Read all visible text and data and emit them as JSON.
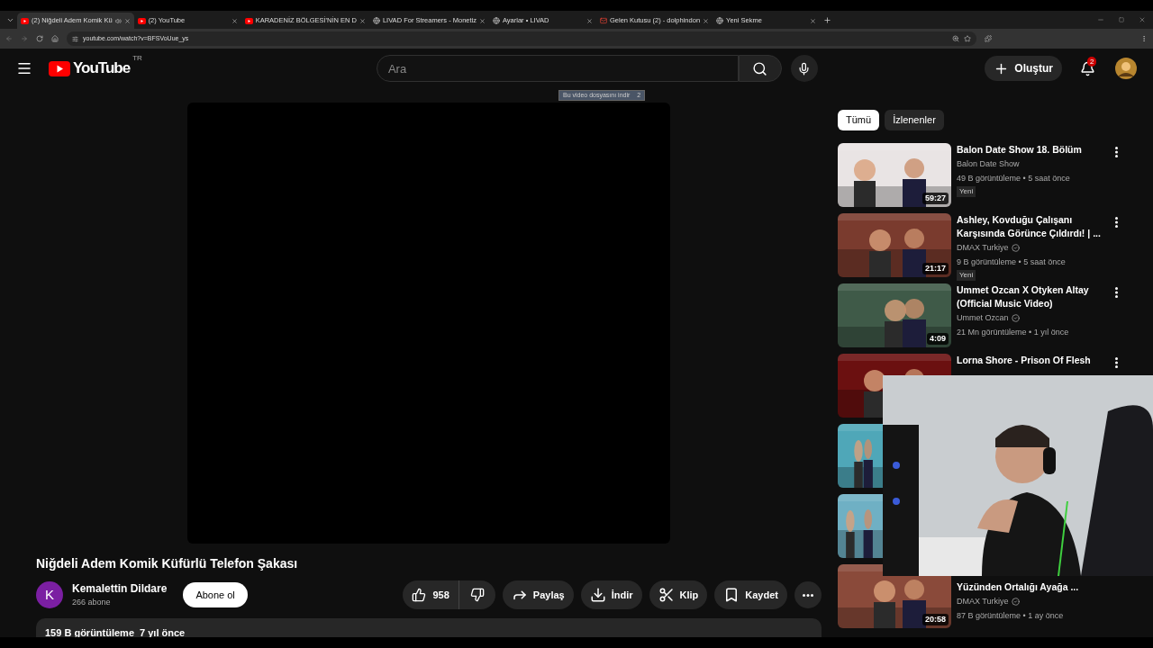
{
  "browser": {
    "tabs": [
      {
        "title": "(2) Niğdeli Adem Komik Kü",
        "selected": true,
        "kind": "youtube",
        "audio": true
      },
      {
        "title": "(2) YouTube",
        "selected": false,
        "kind": "youtube",
        "audio": false
      },
      {
        "title": "KARADENİZ BÖLGESİ'NİN EN D",
        "selected": false,
        "kind": "youtube",
        "audio": false
      },
      {
        "title": "LIVAD For Streamers - Monetiz",
        "selected": false,
        "kind": "globe",
        "audio": false
      },
      {
        "title": "Ayarlar • LIVAD",
        "selected": false,
        "kind": "globe",
        "audio": false
      },
      {
        "title": "Gelen Kutusu (2) - dolphindon",
        "selected": false,
        "kind": "mail",
        "audio": false
      },
      {
        "title": "Yeni Sekme",
        "selected": false,
        "kind": "globe",
        "audio": false
      }
    ],
    "url": "youtube.com/watch?v=BFSVoUue_ys"
  },
  "header": {
    "logo": "YouTube",
    "region": "TR",
    "search_placeholder": "Ara",
    "create": "Oluştur",
    "notifications": "2"
  },
  "player": {
    "download_bar": "Bu video dosyasını indir",
    "download_count": "2"
  },
  "video": {
    "title": "Niğdeli Adem Komik Küfürlü Telefon Şakası",
    "channel": "Kemalettin Dildare",
    "avatar_letter": "K",
    "subscribers": "266 abone",
    "subscribe": "Abone ol",
    "likes": "958",
    "actions": [
      {
        "label": "Paylaş",
        "kind": "share"
      },
      {
        "label": "İndir",
        "kind": "download"
      },
      {
        "label": "Klip",
        "kind": "clip"
      },
      {
        "label": "Kaydet",
        "kind": "save"
      }
    ],
    "views": "159 B görüntüleme",
    "age": "7 yıl önce"
  },
  "chips": [
    {
      "label": "Tümü",
      "selected": true
    },
    {
      "label": "İzlenenler",
      "selected": false
    }
  ],
  "recommendations": [
    {
      "title": "Balon Date Show 18. Bölüm",
      "channel": "Balon Date Show",
      "verified": false,
      "meta": "49 B görüntüleme • 5 saat önce",
      "badge": "Yeni",
      "duration": "59:27",
      "color": "#e9e4e4"
    },
    {
      "title": "Ashley, Kovduğu Çalışanı Karşısında Görünce Çıldırdı! | ...",
      "channel": "DMAX Turkiye",
      "verified": true,
      "meta": "9 B görüntüleme • 5 saat önce",
      "badge": "Yeni",
      "duration": "21:17",
      "color": "#7a3b2e"
    },
    {
      "title": "Ummet Ozcan X Otyken   Altay (Official Music Video)",
      "channel": "Ummet Ozcan",
      "verified": true,
      "meta": "21 Mn görüntüleme • 1 yıl önce",
      "duration": "4:09",
      "color": "#3f5a48"
    },
    {
      "title": "Lorna Shore - Prison Of Flesh",
      "color": "#6b1010"
    },
    {
      "color": "#4fa7b8"
    },
    {
      "color": "#6fb0c4"
    },
    {
      "title": "Yüzünden Ortalığı Ayağa ...",
      "channel": "DMAX Turkiye",
      "verified": true,
      "meta": "87 B görüntüleme • 1 ay önce",
      "duration": "20:58",
      "color": "#8a4a3a"
    }
  ]
}
